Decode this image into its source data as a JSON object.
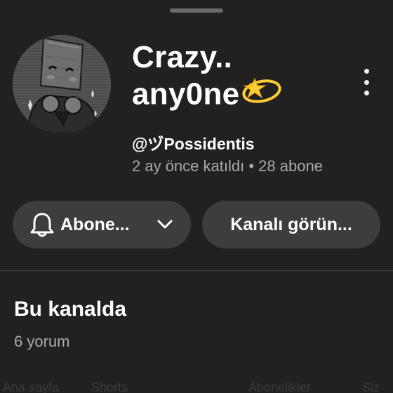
{
  "channel": {
    "title_line1": "Crazy..",
    "title_line2": "any0ne",
    "title_emoji": "dizzy-star-icon",
    "handle": "@ヅPossidentis",
    "joined": "2 ay önce katıldı",
    "separator": " • ",
    "subscribers": "28 abone"
  },
  "actions": {
    "subscribe_label": "Abone...",
    "subscribe_icon": "bell-icon",
    "dropdown_icon": "chevron-down-icon",
    "view_channel_label": "Kanalı görün...",
    "more_icon": "more-vertical-icon"
  },
  "section": {
    "title": "Bu kanalda",
    "subtitle": "6 yorum"
  },
  "bottom_nav": {
    "items": [
      "Ana sayfa",
      "Shorts",
      "Abonelikler",
      "Siz"
    ]
  },
  "colors": {
    "background": "#212121",
    "pill": "#3d3d3d",
    "secondary_text": "#aaaaaa",
    "emoji_yellow": "#ffcc33"
  }
}
